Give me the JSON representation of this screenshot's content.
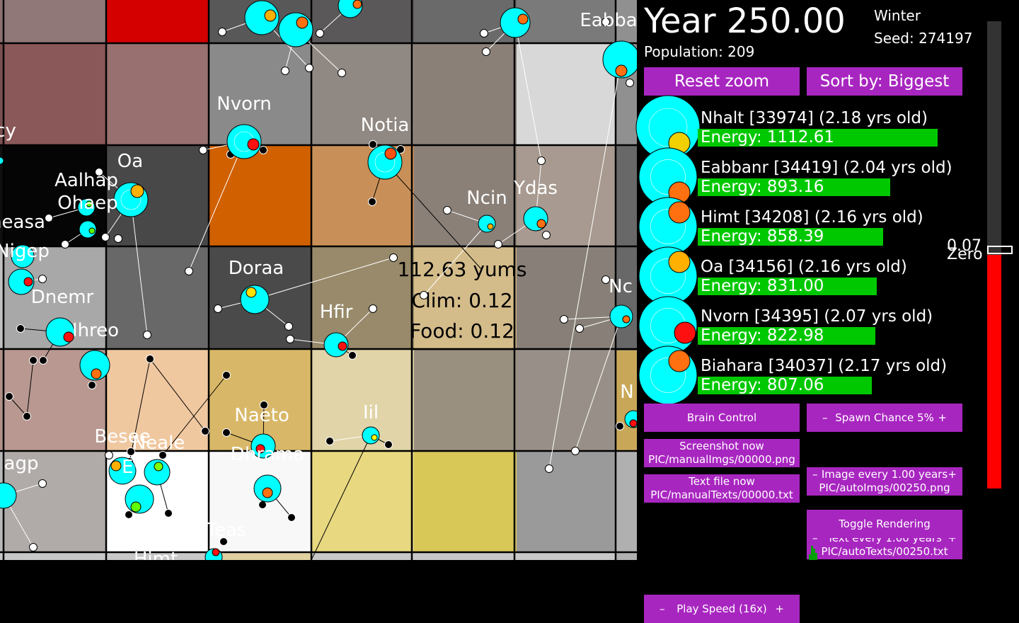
{
  "world": {
    "tooltip": {
      "line1": "112.63 yums",
      "line2": "Clim: 0.12",
      "line3": "Food: 0.12"
    },
    "creature_names": [
      "Nvorn",
      "Notia",
      "Oa",
      "Aalhap",
      "Ohaep",
      "heasa",
      "Nigep",
      "Dnemr",
      "Ihreo",
      "Doraa",
      "Hfir",
      "Ncin",
      "Ydas",
      "Nc",
      "Naeto",
      "Iil",
      "Besee",
      "Neale",
      "Ev",
      "Dhrama",
      "agp",
      "Eabba",
      "cy",
      "N",
      "Himt",
      "Teas"
    ]
  },
  "panel": {
    "year": "Year 250.00",
    "season": "Winter",
    "seed": "Seed: 274197",
    "population": "Population: 209",
    "buttons": {
      "reset_zoom": "Reset zoom",
      "sort_by": "Sort by: Biggest",
      "brain_control": "Brain Control",
      "spawn_chance": "Spawn Chance 5%",
      "screenshot_now": "Screenshot now",
      "screenshot_path": "PIC/manualImgs/00000.png",
      "image_every": "Image every 1.00 years",
      "image_path": "PIC/autoImgs/00250.png",
      "text_now": "Text file now",
      "text_path": "PIC/manualTexts/00000.txt",
      "text_every": "Text every 1.00 years",
      "text_auto_path": "PIC/autoTexts/00250.txt",
      "play_speed": "Play Speed (16x)",
      "toggle_rendering": "Toggle Rendering",
      "minus": "–",
      "plus": "+"
    },
    "rankings": [
      {
        "name": "Nhalt [33974] (2.18 yrs old)",
        "energy": "Energy: 1112.61",
        "energy_value": 1112.61,
        "mouth_color": "#f0d000"
      },
      {
        "name": "Eabbanr [34419] (2.04 yrs old)",
        "energy": "Energy: 893.16",
        "energy_value": 893.16,
        "mouth_color": "#ff7010"
      },
      {
        "name": "Himt [34208] (2.16 yrs old)",
        "energy": "Energy: 858.39",
        "energy_value": 858.39,
        "mouth_color": "#ff7010"
      },
      {
        "name": "Oa [34156] (2.16 yrs old)",
        "energy": "Energy: 831.00",
        "energy_value": 831.0,
        "mouth_color": "#ffb000"
      },
      {
        "name": "Nvorn [34395] (2.07 yrs old)",
        "energy": "Energy: 822.98",
        "energy_value": 822.98,
        "mouth_color": "#ff1010"
      },
      {
        "name": "Biahara [34037] (2.17 yrs old)",
        "energy": "Energy: 807.06",
        "energy_value": 807.06,
        "mouth_color": "#ff7010"
      }
    ],
    "temperature": {
      "value": 0.07,
      "label_value": "0.07",
      "label_zero": "Zero",
      "fill_fraction": 0.5
    },
    "colors": {
      "button": "#a826c0",
      "energy_bar": "#00c800",
      "creature_body": "#00ffff"
    }
  }
}
